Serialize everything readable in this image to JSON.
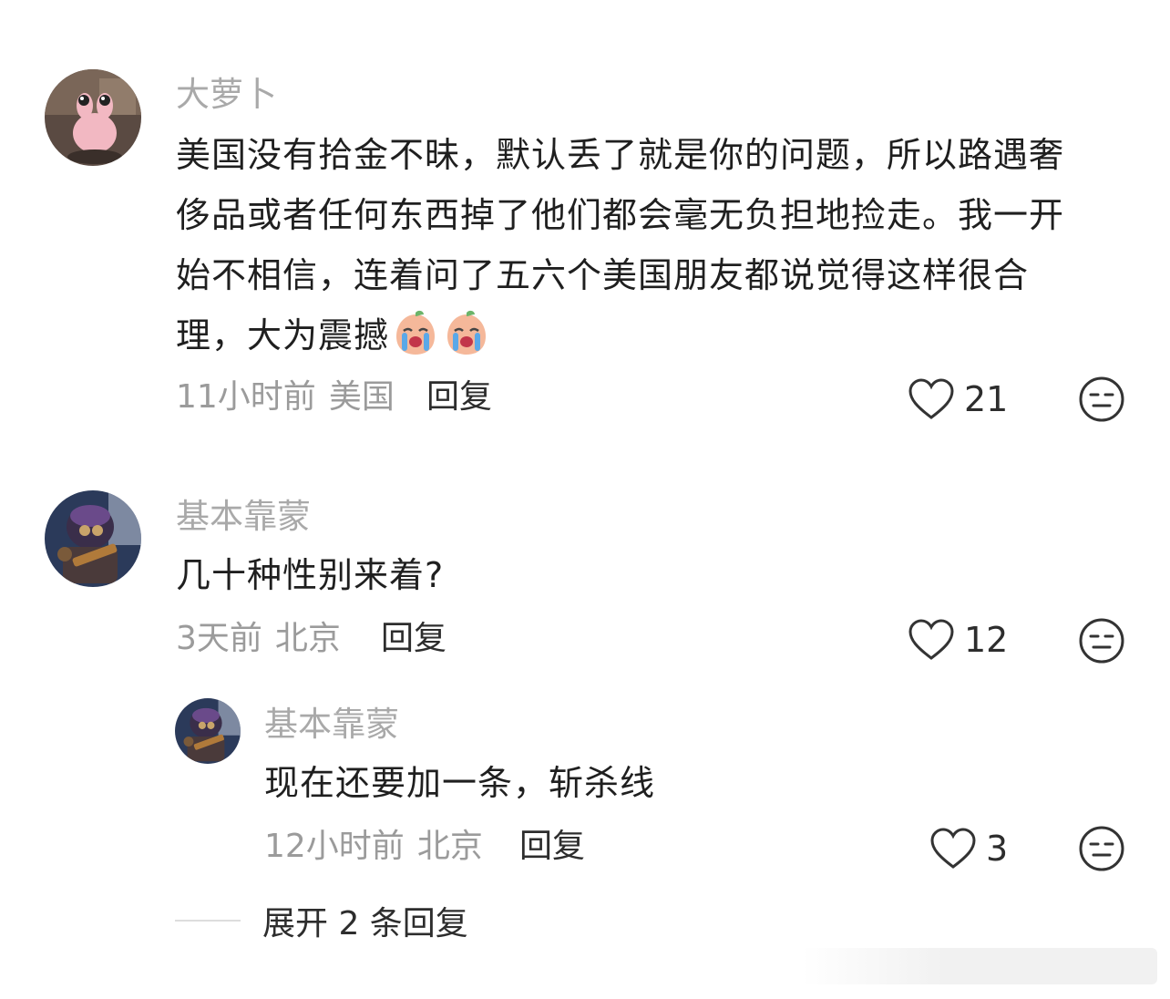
{
  "comments": [
    {
      "username": "大萝卜",
      "lines": [
        "美国没有拾金不昧，默认丢了就是你的问题，所以路遇奢",
        "侈品或者任何东西掉了他们都会毫无负担地捡走。我一开",
        "始不相信，连着问了五六个美国朋友都说觉得这样很合",
        "理，大为震撼"
      ],
      "emoji": "crying-face-emoji",
      "time": "11小时前",
      "location": "美国",
      "reply_label": "回复",
      "likes": "21"
    },
    {
      "username": "基本靠蒙",
      "lines": [
        "几十种性别来着?"
      ],
      "time": "3天前",
      "location": "北京",
      "reply_label": "回复",
      "likes": "12"
    }
  ],
  "reply": {
    "username": "基本靠蒙",
    "lines": [
      "现在还要加一条，斩杀线"
    ],
    "time": "12小时前",
    "location": "北京",
    "reply_label": "回复",
    "likes": "3"
  },
  "expand_replies": "展开 2 条回复",
  "colors": {
    "username": "#a9a9a9",
    "meta": "#9b9b9b",
    "text": "#1f1f1f",
    "action": "#2d2d2d"
  },
  "icons": [
    "heart-icon",
    "neutral-face-icon",
    "crying-face-emoji"
  ]
}
